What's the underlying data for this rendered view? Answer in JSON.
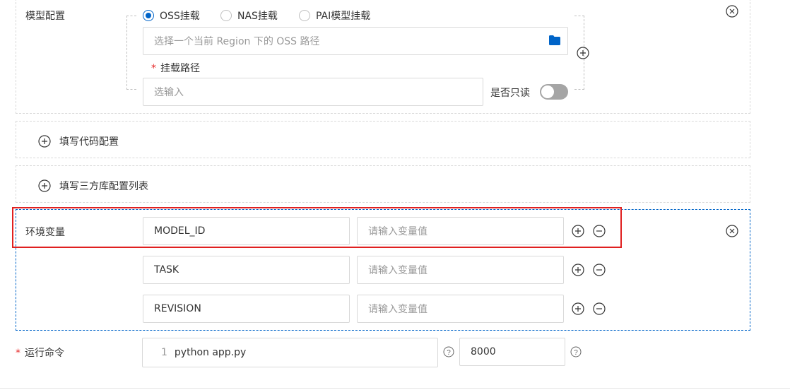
{
  "model_config": {
    "label": "模型配置",
    "radios": [
      {
        "label": "OSS挂载",
        "selected": true
      },
      {
        "label": "NAS挂载",
        "selected": false
      },
      {
        "label": "PAI模型挂载",
        "selected": false
      }
    ],
    "oss_path_placeholder": "选择一个当前 Region 下的 OSS 路径",
    "mount_path_label": "挂载路径",
    "mount_path_placeholder": "选输入",
    "readonly_label": "是否只读",
    "readonly_on": false
  },
  "code_config": {
    "label": "填写代码配置"
  },
  "third_party": {
    "label": "填写三方库配置列表"
  },
  "env": {
    "label": "环境变量",
    "value_placeholder": "请输入变量值",
    "rows": [
      {
        "name": "MODEL_ID",
        "value": ""
      },
      {
        "name": "TASK",
        "value": ""
      },
      {
        "name": "REVISION",
        "value": ""
      }
    ]
  },
  "run_command": {
    "label": "运行命令",
    "line_no": "1",
    "command": "python app.py",
    "port": "8000"
  },
  "colors": {
    "accent": "#0064c8",
    "highlight": "#e02020",
    "required": "#e62e2e"
  }
}
